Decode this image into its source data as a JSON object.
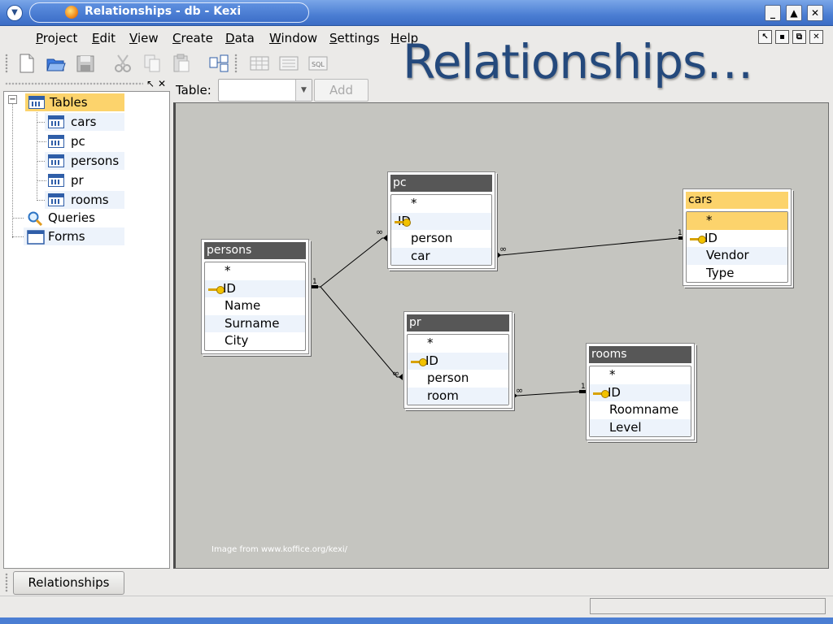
{
  "window": {
    "title": "Relationships - db - Kexi"
  },
  "menu": [
    "Project",
    "Edit",
    "View",
    "Create",
    "Data",
    "Window",
    "Settings",
    "Help"
  ],
  "menu_mnemonic": [
    "P",
    "E",
    "V",
    "C",
    "D",
    "W",
    "S",
    "H"
  ],
  "heading": "Relationships…",
  "navigator": {
    "items": [
      {
        "label": "Tables",
        "icon": "table-icon"
      },
      {
        "label": "cars",
        "icon": "table-icon"
      },
      {
        "label": "pc",
        "icon": "table-icon"
      },
      {
        "label": "persons",
        "icon": "table-icon"
      },
      {
        "label": "pr",
        "icon": "table-icon"
      },
      {
        "label": "rooms",
        "icon": "table-icon"
      },
      {
        "label": "Queries",
        "icon": "magnifier-icon"
      },
      {
        "label": "Forms",
        "icon": "form-icon"
      }
    ]
  },
  "table_toolbar": {
    "label": "Table:",
    "combo_value": "",
    "add_label": "Add"
  },
  "tables": {
    "pc": {
      "title": "pc",
      "fields": [
        "*",
        "ID",
        "person",
        "car"
      ]
    },
    "cars": {
      "title": "cars",
      "fields": [
        "*",
        "ID",
        "Vendor",
        "Type"
      ]
    },
    "persons": {
      "title": "persons",
      "fields": [
        "*",
        "ID",
        "Name",
        "Surname",
        "City"
      ]
    },
    "pr": {
      "title": "pr",
      "fields": [
        "*",
        "ID",
        "person",
        "room"
      ]
    },
    "rooms": {
      "title": "rooms",
      "fields": [
        "*",
        "ID",
        "Roomname",
        "Level"
      ]
    }
  },
  "relationships": [
    {
      "from": "persons.ID",
      "to": "pc.person",
      "one": "1",
      "many": "∞"
    },
    {
      "from": "persons.ID",
      "to": "pr.person",
      "one": "1",
      "many": "∞"
    },
    {
      "from": "cars.ID",
      "to": "pc.car",
      "one": "1",
      "many": "∞"
    },
    {
      "from": "rooms.ID",
      "to": "pr.room",
      "one": "1",
      "many": "∞"
    }
  ],
  "credit": "Image from www.koffice.org/kexi/",
  "taskbar": {
    "tab": "Relationships"
  },
  "status": {
    "text": ""
  },
  "colors": {
    "title_bar": "#4b7ed3",
    "selection": "#fcd36c",
    "canvas": "#c5c5c0",
    "heading": "#24497c"
  }
}
